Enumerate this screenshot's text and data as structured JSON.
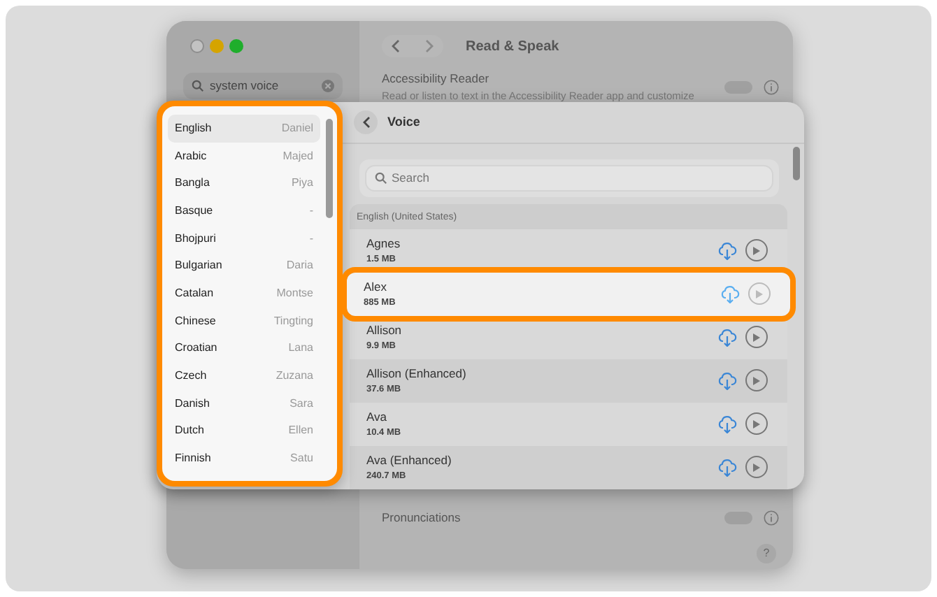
{
  "window": {
    "title": "Read & Speak",
    "search": {
      "value": "system voice"
    },
    "settings": [
      {
        "label": "Accessibility Reader",
        "description": "Read or listen to text in the Accessibility Reader app and customize",
        "on": false
      },
      {
        "label": "Pronunciations",
        "on": false
      }
    ],
    "help": "?"
  },
  "language_list": {
    "highlighted": true,
    "items": [
      {
        "language": "English",
        "voice": "Daniel",
        "selected": true
      },
      {
        "language": "Arabic",
        "voice": "Majed",
        "selected": false
      },
      {
        "language": "Bangla",
        "voice": "Piya",
        "selected": false
      },
      {
        "language": "Basque",
        "voice": "-",
        "selected": false
      },
      {
        "language": "Bhojpuri",
        "voice": "-",
        "selected": false
      },
      {
        "language": "Bulgarian",
        "voice": "Daria",
        "selected": false
      },
      {
        "language": "Catalan",
        "voice": "Montse",
        "selected": false
      },
      {
        "language": "Chinese",
        "voice": "Tingting",
        "selected": false
      },
      {
        "language": "Croatian",
        "voice": "Lana",
        "selected": false
      },
      {
        "language": "Czech",
        "voice": "Zuzana",
        "selected": false
      },
      {
        "language": "Danish",
        "voice": "Sara",
        "selected": false
      },
      {
        "language": "Dutch",
        "voice": "Ellen",
        "selected": false
      },
      {
        "language": "Finnish",
        "voice": "Satu",
        "selected": false
      }
    ]
  },
  "voice_sheet": {
    "title": "Voice",
    "search": {
      "placeholder": "Search"
    },
    "group": "English (United States)",
    "voices": [
      {
        "name": "Agnes",
        "size": "1.5 MB",
        "selected": false
      },
      {
        "name": "Alex",
        "size": "885 MB",
        "selected": true
      },
      {
        "name": "Allison",
        "size": "9.9 MB",
        "selected": false
      },
      {
        "name": "Allison (Enhanced)",
        "size": "37.6 MB",
        "selected": false
      },
      {
        "name": "Ava",
        "size": "10.4 MB",
        "selected": false
      },
      {
        "name": "Ava (Enhanced)",
        "size": "240.7 MB",
        "selected": false
      }
    ]
  }
}
